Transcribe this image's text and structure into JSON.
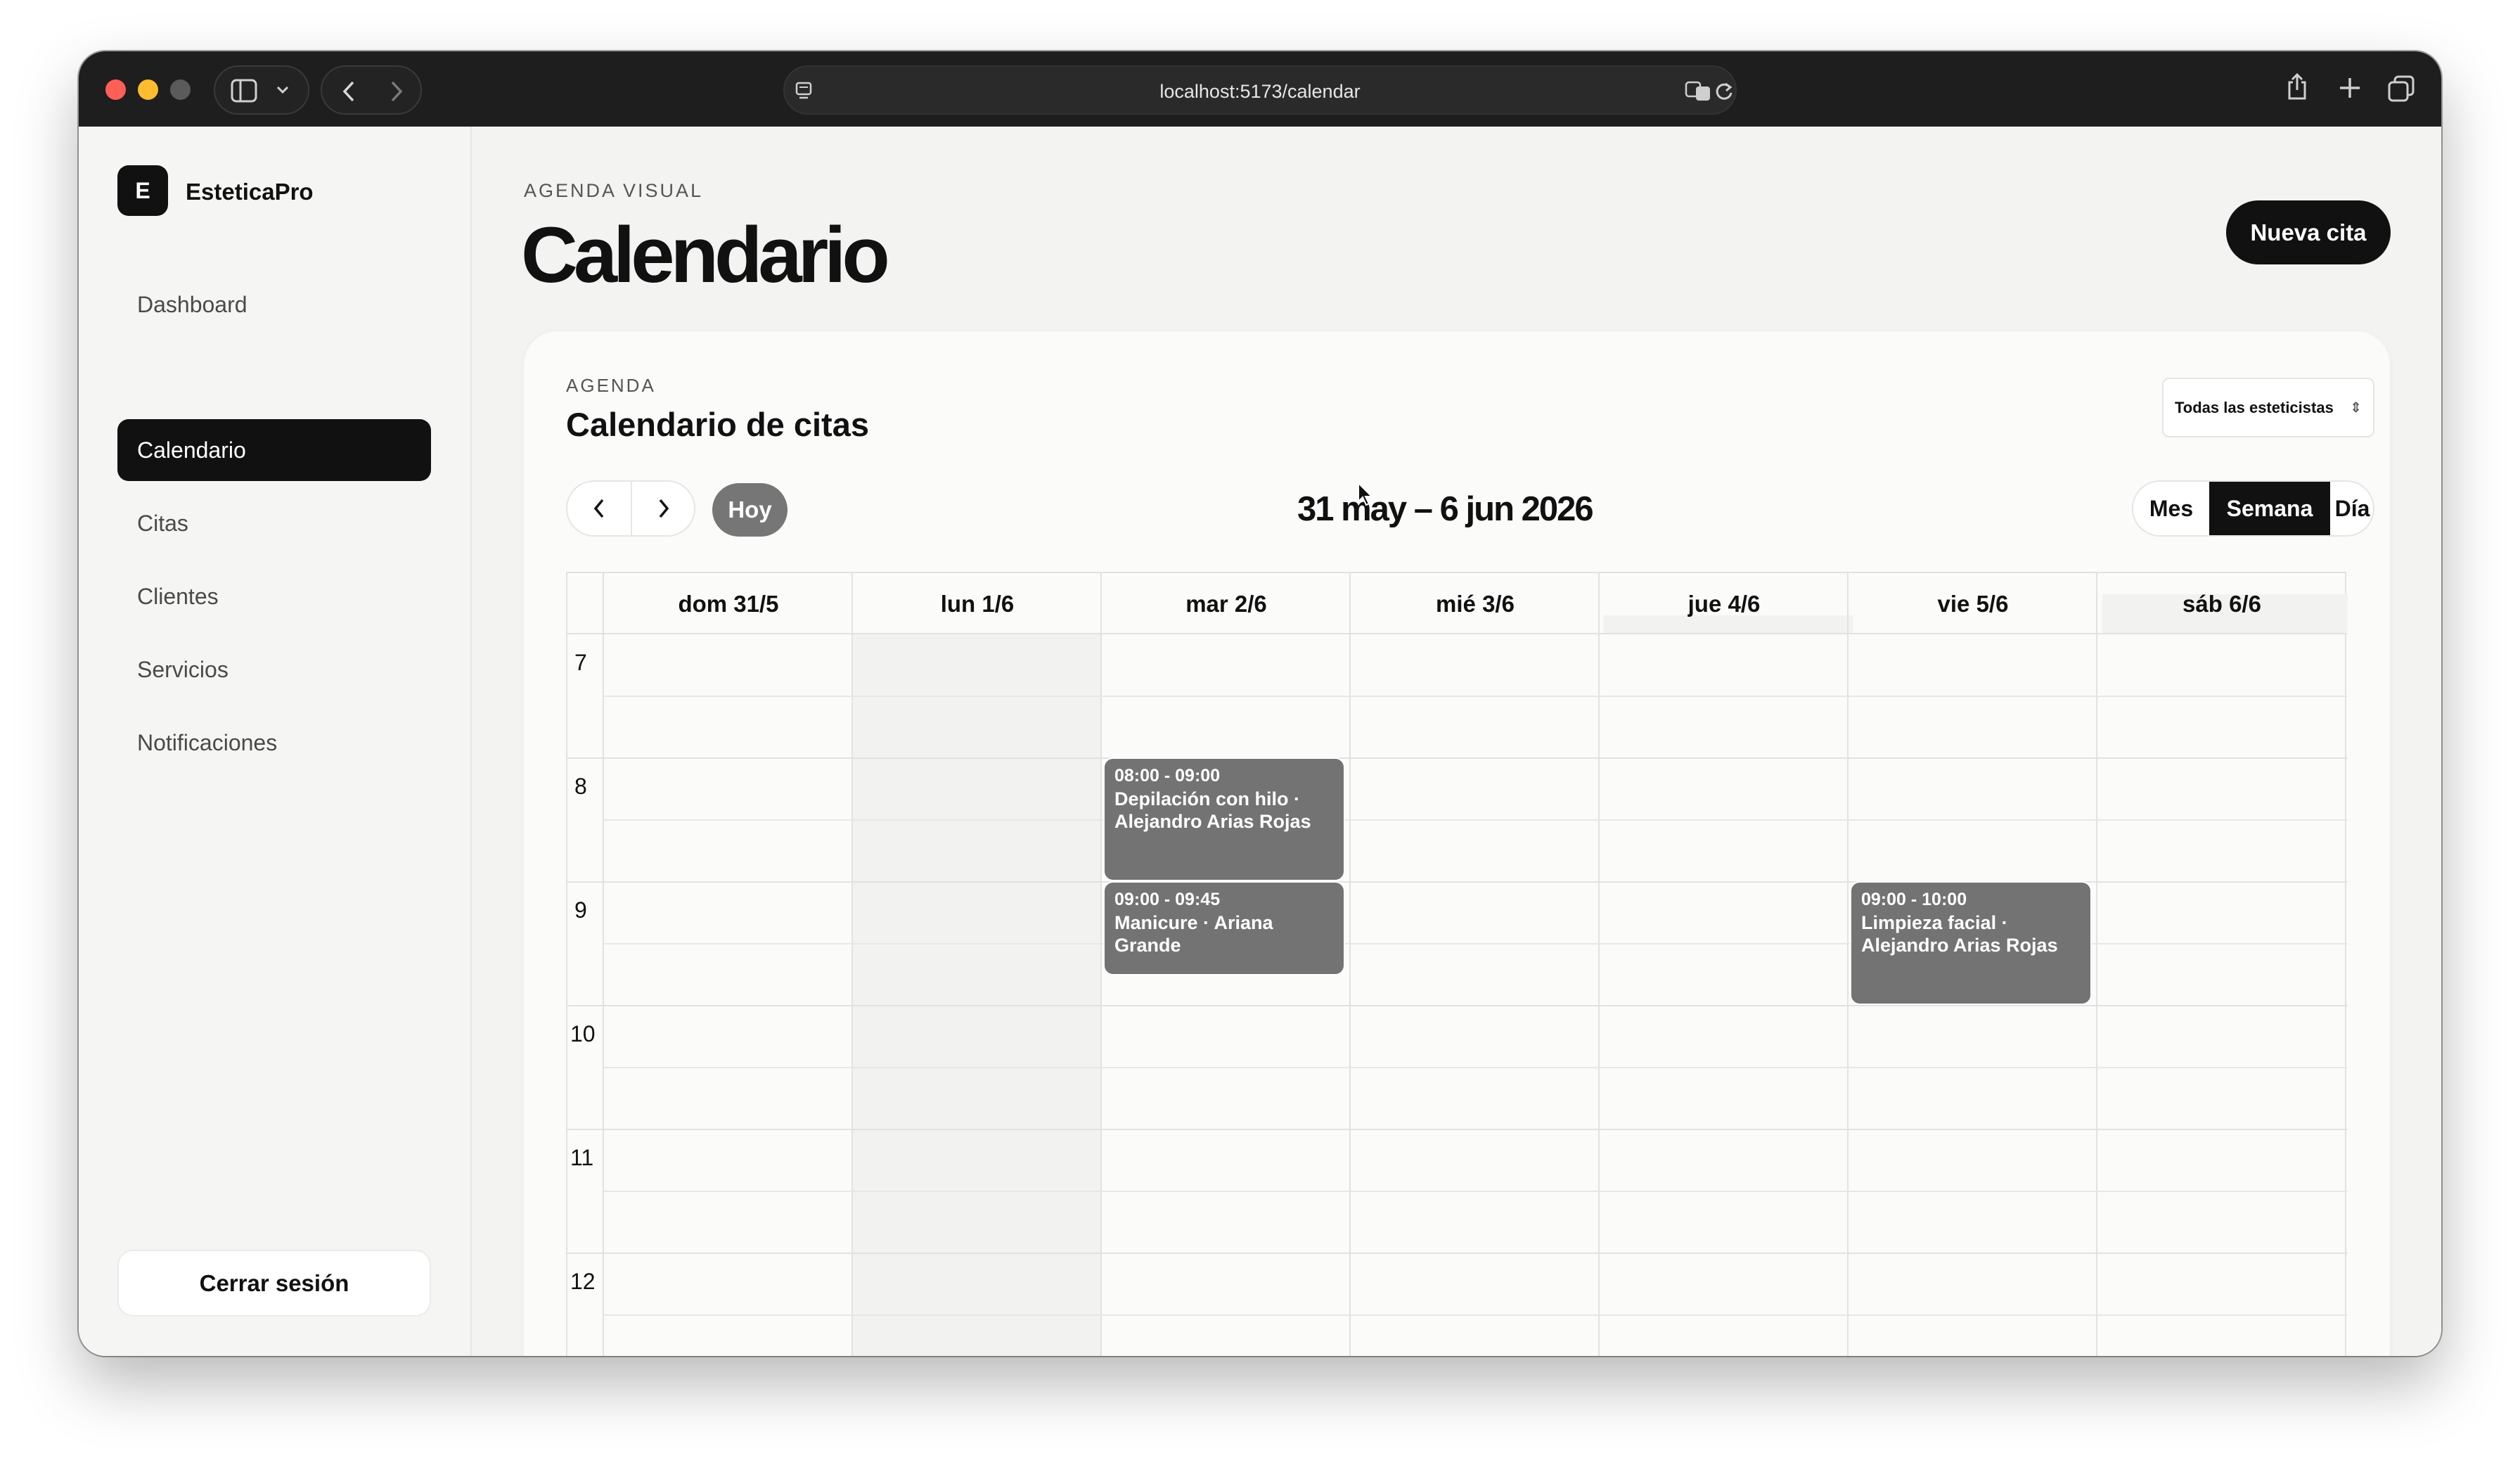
{
  "browser": {
    "url": "localhost:5173/calendar",
    "icons": [
      "sidebar-toggle-icon",
      "chevron-down-icon",
      "back-icon",
      "forward-icon",
      "site-icon",
      "translate-icon",
      "reload-icon",
      "share-icon",
      "new-tab-icon",
      "tabs-overview-icon"
    ]
  },
  "sidebar": {
    "logo_letter": "E",
    "brand": "EsteticaPro",
    "items": [
      {
        "label": "Dashboard"
      },
      {
        "label": "Calendario",
        "active": true
      },
      {
        "label": "Citas"
      },
      {
        "label": "Clientes"
      },
      {
        "label": "Servicios"
      },
      {
        "label": "Notificaciones"
      }
    ],
    "logout": "Cerrar sesión"
  },
  "header": {
    "eyebrow": "AGENDA VISUAL",
    "title": "Calendario",
    "new_button": "Nueva cita"
  },
  "calendar": {
    "eyebrow": "AGENDA",
    "title": "Calendario de citas",
    "staff_filter": "Todas las esteticistas",
    "today": "Hoy",
    "range": "31 may – 6 jun 2026",
    "views": [
      "Mes",
      "Semana",
      "Día"
    ],
    "active_view": "Semana",
    "days": [
      "dom 31/5",
      "lun 1/6",
      "mar 2/6",
      "mié 3/6",
      "jue 4/6",
      "vie 5/6",
      "sáb 6/6"
    ],
    "hours": [
      "7",
      "8",
      "9",
      "10",
      "11",
      "12"
    ],
    "events": [
      {
        "time": "08:00 - 09:00",
        "desc": "Depilación con hilo · Alejandro Arias Rojas",
        "day": "mar 2/6"
      },
      {
        "time": "09:00 - 09:45",
        "desc": "Manicure · Ariana Grande",
        "day": "mar 2/6"
      },
      {
        "time": "09:00 - 10:00",
        "desc": "Limpieza facial · Alejandro Arias Rojas",
        "day": "vie 5/6"
      }
    ],
    "colors": {
      "event": "#737373",
      "active": "#111111",
      "today_button": "#767676"
    }
  }
}
